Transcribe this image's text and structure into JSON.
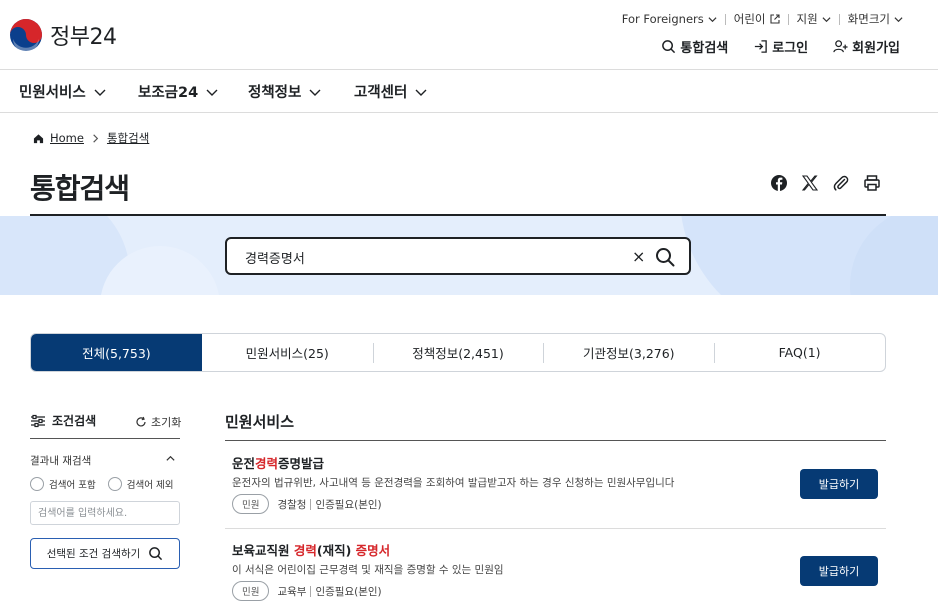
{
  "header": {
    "logo_text": "정부24",
    "utility": {
      "foreigners": "For Foreigners",
      "kids": "어린이",
      "support": "지원",
      "font_size": "화면크기"
    },
    "main_links": {
      "search": "통합검색",
      "login": "로그인",
      "signup": "회원가입"
    }
  },
  "nav": {
    "items": [
      "민원서비스",
      "보조금24",
      "정책정보",
      "고객센터"
    ]
  },
  "breadcrumb": {
    "home": "Home",
    "current": "통합검색"
  },
  "page_title": "통합검색",
  "search": {
    "value": "경력증명서",
    "clear": "×"
  },
  "tabs": [
    {
      "label": "전체(5,753)",
      "active": true
    },
    {
      "label": "민원서비스(25)",
      "active": false
    },
    {
      "label": "정책정보(2,451)",
      "active": false
    },
    {
      "label": "기관정보(3,276)",
      "active": false
    },
    {
      "label": "FAQ(1)",
      "active": false
    }
  ],
  "filter": {
    "title": "조건검색",
    "reset": "초기화",
    "refine_title": "결과내 재검색",
    "include": "검색어 포함",
    "exclude": "검색어 제외",
    "placeholder": "검색어를 입력하세요.",
    "submit": "선택된 조건 검색하기"
  },
  "results": {
    "section_title": "민원서비스",
    "items": [
      {
        "title_pre": "운전",
        "title_hl": "경력",
        "title_post": "증명발급",
        "desc": "운전자의 법규위반, 사고내역 등 운전경력을 조회하여 발급받고자 하는 경우 신청하는 민원사무입니다",
        "badge": "민원",
        "agency": "경찰청",
        "auth": "인증필요(본인)",
        "button": "발급하기"
      },
      {
        "title_pre": "보육교직원 ",
        "title_hl": "경력",
        "title_mid": "(재직) ",
        "title_hl2": "증명서",
        "desc": "이 서식은 어린이집 근무경력 및 재직을 증명할 수 있는 민원임",
        "badge": "민원",
        "agency": "교육부",
        "auth": "인증필요(본인)",
        "button": "발급하기"
      }
    ]
  },
  "colors": {
    "primary": "#063a74",
    "highlight": "#d6262a",
    "band": "#e4eefc"
  }
}
